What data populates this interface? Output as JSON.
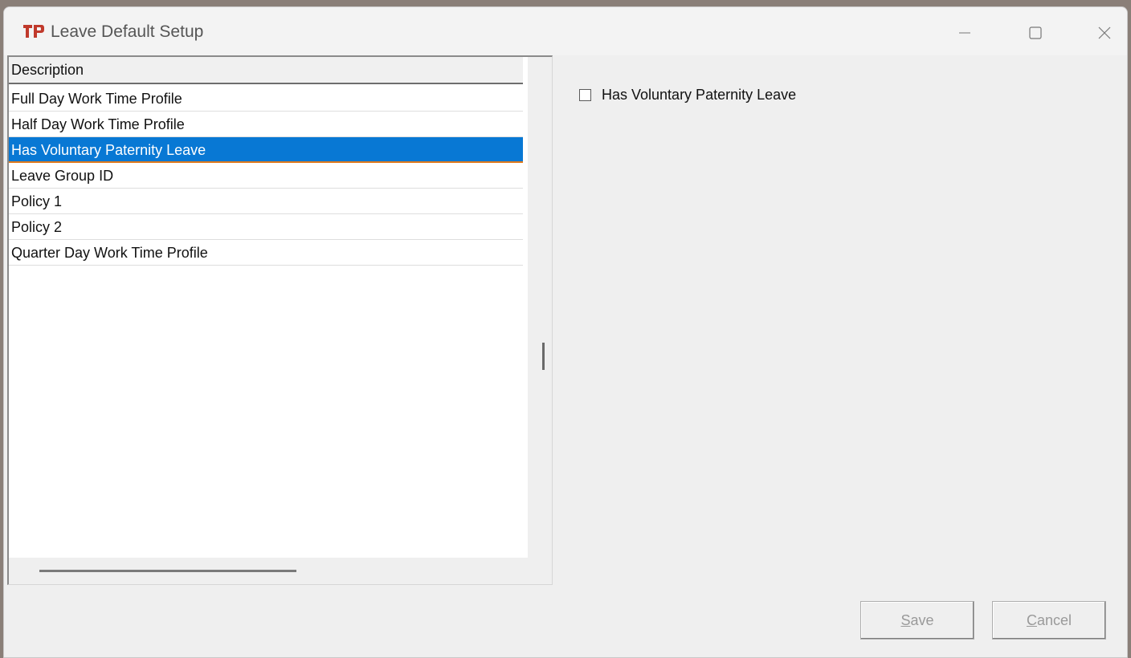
{
  "window": {
    "title": "Leave Default Setup",
    "accent_color": "#0878d4",
    "icons": {
      "app": "leave-app-logo-icon",
      "minimize": "minimize-icon",
      "maximize": "maximize-icon",
      "close": "close-icon"
    }
  },
  "list": {
    "column_header": "Description",
    "rows": [
      "Full Day Work Time Profile",
      "Half Day Work Time Profile",
      "Has Voluntary Paternity Leave",
      "Leave Group ID",
      "Policy 1",
      "Policy 2",
      "Quarter Day Work Time Profile"
    ],
    "selected_row": "Has Voluntary Paternity Leave"
  },
  "detail": {
    "checkbox_label": "Has Voluntary Paternity Leave",
    "checked": false
  },
  "buttons": {
    "save_accel": "S",
    "save_rest": "ave",
    "cancel_accel": "C",
    "cancel_rest": "ancel"
  }
}
